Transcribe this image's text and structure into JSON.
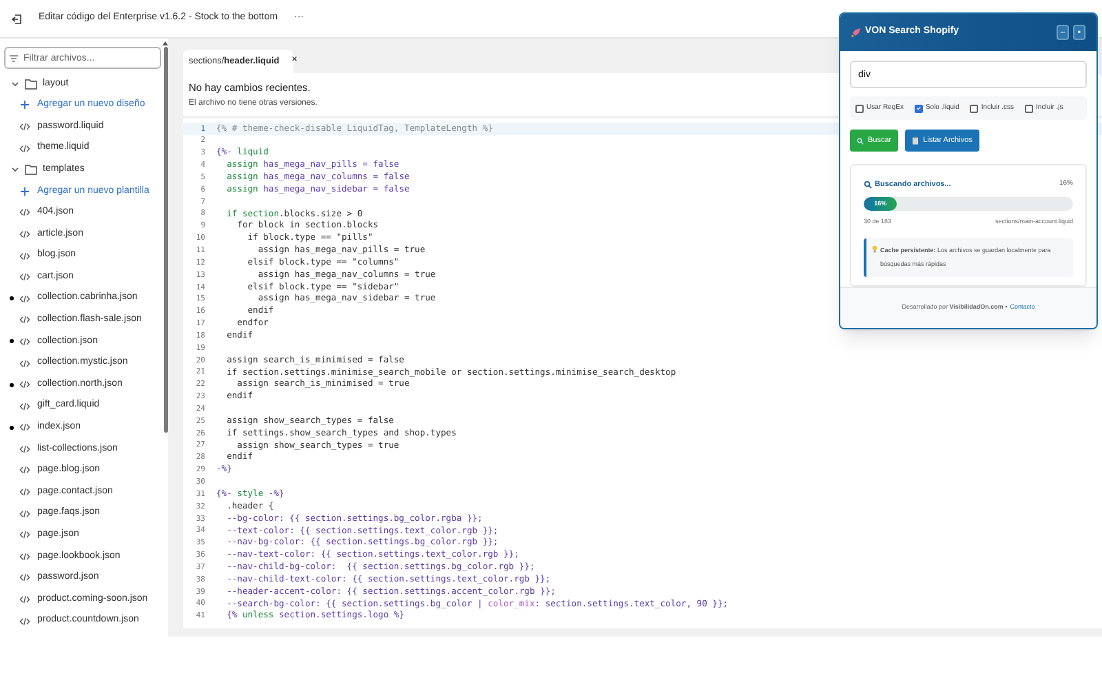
{
  "topbar": {
    "title": "Editar código del Enterprise v1.6.2 - Stock to the bottom",
    "menu": "···"
  },
  "sidebar": {
    "filter_placeholder": "Filtrar archivos...",
    "items": [
      {
        "kind": "folder",
        "label": "layout",
        "expanded": true,
        "children": [
          {
            "kind": "add",
            "label": "Agregar un nuevo diseño"
          },
          {
            "kind": "file",
            "label": "password.liquid",
            "modified": false
          },
          {
            "kind": "file",
            "label": "theme.liquid",
            "modified": false
          }
        ]
      },
      {
        "kind": "folder",
        "label": "templates",
        "expanded": true,
        "children": [
          {
            "kind": "add",
            "label": "Agregar un nuevo plantilla"
          },
          {
            "kind": "file",
            "label": "404.json",
            "modified": false
          },
          {
            "kind": "file",
            "label": "article.json",
            "modified": false
          },
          {
            "kind": "file",
            "label": "blog.json",
            "modified": false
          },
          {
            "kind": "file",
            "label": "cart.json",
            "modified": false
          },
          {
            "kind": "file",
            "label": "collection.cabrinha.json",
            "modified": true
          },
          {
            "kind": "file",
            "label": "collection.flash-sale.json",
            "modified": false
          },
          {
            "kind": "file",
            "label": "collection.json",
            "modified": true
          },
          {
            "kind": "file",
            "label": "collection.mystic.json",
            "modified": false
          },
          {
            "kind": "file",
            "label": "collection.north.json",
            "modified": true
          },
          {
            "kind": "file",
            "label": "gift_card.liquid",
            "modified": false
          },
          {
            "kind": "file",
            "label": "index.json",
            "modified": true
          },
          {
            "kind": "file",
            "label": "list-collections.json",
            "modified": false
          },
          {
            "kind": "file",
            "label": "page.blog.json",
            "modified": false
          },
          {
            "kind": "file",
            "label": "page.contact.json",
            "modified": false
          },
          {
            "kind": "file",
            "label": "page.faqs.json",
            "modified": false
          },
          {
            "kind": "file",
            "label": "page.json",
            "modified": false
          },
          {
            "kind": "file",
            "label": "page.lookbook.json",
            "modified": false
          },
          {
            "kind": "file",
            "label": "password.json",
            "modified": false
          },
          {
            "kind": "file",
            "label": "product.coming-soon.json",
            "modified": false
          },
          {
            "kind": "file",
            "label": "product.countdown.json",
            "modified": false
          }
        ]
      }
    ]
  },
  "editor": {
    "tab": {
      "folder": "sections/",
      "file": "header.liquid",
      "close": "×",
      "selected": true
    },
    "history_title": "No hay cambios recientes.",
    "history_note": "El archivo no tiene otras versiones.",
    "lines": [
      {
        "n": "1",
        "active": true,
        "tokens": [
          {
            "text": "{% # theme-check-disable LiquidTag, TemplateLength %}",
            "kind": "comment"
          }
        ]
      },
      {
        "n": "2",
        "active": false
      },
      {
        "n": "3",
        "active": false,
        "tokens": [
          {
            "text": "{%- ",
            "kind": "tag"
          },
          {
            "text": "liquid",
            "kind": "keyword"
          }
        ]
      },
      {
        "n": "4",
        "active": false,
        "tokens": [
          {
            "text": "  assign ",
            "kind": "keyword"
          },
          {
            "text": "has_mega_nav_pills = false",
            "kind": "tag"
          }
        ]
      },
      {
        "n": "5",
        "active": false,
        "tokens": [
          {
            "text": "  assign ",
            "kind": "keyword"
          },
          {
            "text": "has_mega_nav_columns = false",
            "kind": "tag"
          }
        ]
      },
      {
        "n": "6",
        "active": false,
        "tokens": [
          {
            "text": "  assign ",
            "kind": "keyword"
          },
          {
            "text": "has_mega_nav_sidebar = false",
            "kind": "tag"
          }
        ]
      },
      {
        "n": "7",
        "active": false
      },
      {
        "n": "8",
        "active": false,
        "tokens": [
          {
            "text": "  if section",
            "kind": "keyword"
          },
          {
            "text": ".blocks.size > 0",
            "kind": "plain"
          }
        ]
      },
      {
        "n": "9",
        "active": false,
        "tokens": [
          {
            "text": "    for block in section.blocks",
            "kind": "plain"
          }
        ]
      },
      {
        "n": "10",
        "active": false,
        "tokens": [
          {
            "text": "      if block.type == \"pills\"",
            "kind": "plain"
          }
        ]
      },
      {
        "n": "11",
        "active": false,
        "tokens": [
          {
            "text": "        assign has_mega_nav_pills = true",
            "kind": "plain"
          }
        ]
      },
      {
        "n": "12",
        "active": false,
        "tokens": [
          {
            "text": "      elsif block.type == \"columns\"",
            "kind": "plain"
          }
        ]
      },
      {
        "n": "13",
        "active": false,
        "tokens": [
          {
            "text": "        assign has_mega_nav_columns = true",
            "kind": "plain"
          }
        ]
      },
      {
        "n": "14",
        "active": false,
        "tokens": [
          {
            "text": "      elsif block.type == \"sidebar\"",
            "kind": "plain"
          }
        ]
      },
      {
        "n": "15",
        "active": false,
        "tokens": [
          {
            "text": "        assign has_mega_nav_sidebar = true",
            "kind": "plain"
          }
        ]
      },
      {
        "n": "16",
        "active": false,
        "tokens": [
          {
            "text": "      endif",
            "kind": "plain"
          }
        ]
      },
      {
        "n": "17",
        "active": false,
        "tokens": [
          {
            "text": "    endfor",
            "kind": "plain"
          }
        ]
      },
      {
        "n": "18",
        "active": false,
        "tokens": [
          {
            "text": "  endif",
            "kind": "plain"
          }
        ]
      },
      {
        "n": "19",
        "active": false
      },
      {
        "n": "20",
        "active": false,
        "tokens": [
          {
            "text": "  assign search_is_minimised = false",
            "kind": "plain"
          }
        ]
      },
      {
        "n": "21",
        "active": false,
        "tokens": [
          {
            "text": "  if section.settings.minimise_search_mobile or section.settings.minimise_search_desktop",
            "kind": "plain"
          }
        ]
      },
      {
        "n": "22",
        "active": false,
        "tokens": [
          {
            "text": "    assign search_is_minimised = true",
            "kind": "plain"
          }
        ]
      },
      {
        "n": "23",
        "active": false,
        "tokens": [
          {
            "text": "  endif",
            "kind": "plain"
          }
        ]
      },
      {
        "n": "24",
        "active": false
      },
      {
        "n": "25",
        "active": false,
        "tokens": [
          {
            "text": "  assign show_search_types = false",
            "kind": "plain"
          }
        ]
      },
      {
        "n": "26",
        "active": false,
        "tokens": [
          {
            "text": "  if settings.show_search_types and shop.types",
            "kind": "plain"
          }
        ]
      },
      {
        "n": "27",
        "active": false,
        "tokens": [
          {
            "text": "    assign show_search_types = true",
            "kind": "plain"
          }
        ]
      },
      {
        "n": "28",
        "active": false,
        "tokens": [
          {
            "text": "  endif",
            "kind": "plain"
          }
        ]
      },
      {
        "n": "29",
        "active": false,
        "tokens": [
          {
            "text": "-%}",
            "kind": "tag"
          }
        ]
      },
      {
        "n": "30",
        "active": false
      },
      {
        "n": "31",
        "active": false,
        "tokens": [
          {
            "text": "{%- ",
            "kind": "tag"
          },
          {
            "text": "style",
            "kind": "keyword"
          },
          {
            "text": " -%}",
            "kind": "tag"
          }
        ]
      },
      {
        "n": "32",
        "active": false,
        "tokens": [
          {
            "text": "  .header {",
            "kind": "plain"
          }
        ]
      },
      {
        "n": "33",
        "active": false,
        "tokens": [
          {
            "text": "  --bg-color: {{ section.settings.bg_color.rgba }};",
            "kind": "tag"
          }
        ]
      },
      {
        "n": "34",
        "active": false,
        "tokens": [
          {
            "text": "  --text-color: {{ section.settings.text_color.rgb }};",
            "kind": "tag"
          }
        ]
      },
      {
        "n": "35",
        "active": false,
        "tokens": [
          {
            "text": "  --nav-bg-color: {{ section.settings.bg_color.rgb }};",
            "kind": "tag"
          }
        ]
      },
      {
        "n": "36",
        "active": false,
        "tokens": [
          {
            "text": "  --nav-text-color: {{ section.settings.text_color.rgb }};",
            "kind": "tag"
          }
        ]
      },
      {
        "n": "37",
        "active": false,
        "tokens": [
          {
            "text": "  --nav-child-bg-color:  {{ section.settings.bg_color.rgb }};",
            "kind": "tag"
          }
        ]
      },
      {
        "n": "38",
        "active": false,
        "tokens": [
          {
            "text": "  --nav-child-text-color: {{ section.settings.text_color.rgb }};",
            "kind": "tag"
          }
        ]
      },
      {
        "n": "39",
        "active": false,
        "tokens": [
          {
            "text": "  --header-accent-color: {{ section.settings.accent_color.rgb }};",
            "kind": "tag"
          }
        ]
      },
      {
        "n": "40",
        "active": false,
        "tokens": [
          {
            "text": "  --search-bg-color: {{ section.settings.bg_color | ",
            "kind": "tag"
          },
          {
            "text": "color_mix",
            "kind": "filter"
          },
          {
            "text": ": section.settings.text_color, 90 }};",
            "kind": "tag"
          }
        ]
      },
      {
        "n": "41",
        "active": false,
        "tokens": [
          {
            "text": "  {% ",
            "kind": "tag"
          },
          {
            "text": "unless",
            "kind": "keyword"
          },
          {
            "text": " section.settings.logo %}",
            "kind": "tag"
          }
        ]
      }
    ]
  },
  "popup": {
    "title": "VON Search Shopify",
    "minimize": "–",
    "close": "▪",
    "query": "div",
    "options": [
      {
        "label": "Usar RegEx",
        "checked": false
      },
      {
        "label": "Solo .liquid",
        "checked": true
      },
      {
        "label": "Incluir .css",
        "checked": false
      },
      {
        "label": "Incluir .js",
        "checked": false
      }
    ],
    "buttons": [
      {
        "kind": "search",
        "label": "Buscar"
      },
      {
        "kind": "list",
        "label": "Listar Archivos"
      }
    ],
    "progress": {
      "title": "Buscando archivos...",
      "percent": "16%",
      "level": 0.16,
      "bar_label": "16%",
      "count": "30 de 183",
      "current_file": "sections/main-account.liquid"
    },
    "tip": "**Cache persistente:** Los archivos se guardan localmente para búsquedas más rápidas",
    "footer": {
      "text": "Desarrollado por **VisibilidadOn.com** •",
      "link": "Contacto"
    }
  }
}
